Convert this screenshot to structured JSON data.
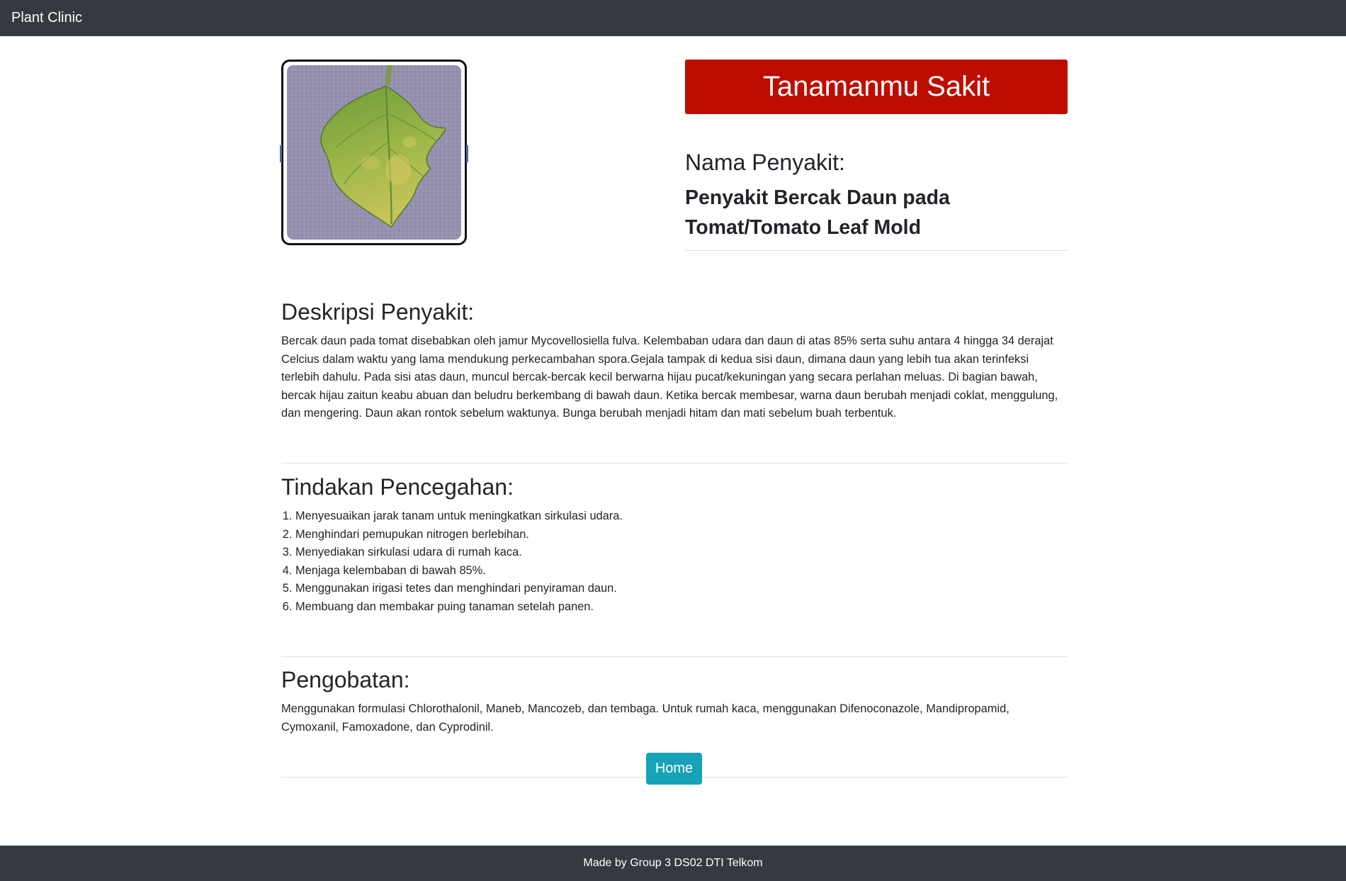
{
  "navbar": {
    "brand": "Plant Clinic"
  },
  "result": {
    "status": "Tanamanmu Sakit",
    "status_color": "#bd0d00",
    "name_label": "Nama Penyakit:",
    "disease_name": "Penyakit Bercak Daun pada Tomat/Tomato Leaf Mold"
  },
  "description": {
    "title": "Deskripsi Penyakit:",
    "text": "Bercak daun pada tomat disebabkan oleh jamur Mycovellosiella fulva. Kelembaban udara dan daun di atas 85% serta suhu antara 4 hingga 34 derajat Celcius dalam waktu yang lama mendukung perkecambahan spora.Gejala tampak di kedua sisi daun, dimana daun yang lebih tua akan terinfeksi terlebih dahulu. Pada sisi atas daun, muncul bercak-bercak kecil berwarna hijau pucat/kekuningan yang secara perlahan meluas. Di bagian bawah, bercak hijau zaitun keabu abuan dan beludru berkembang di bawah daun. Ketika bercak membesar, warna daun berubah menjadi coklat, menggulung, dan mengering. Daun akan rontok sebelum waktunya. Bunga berubah menjadi hitam dan mati sebelum buah terbentuk."
  },
  "prevention": {
    "title": "Tindakan Pencegahan:",
    "items": [
      "Menyesuaikan jarak tanam untuk meningkatkan sirkulasi udara.",
      "Menghindari pemupukan nitrogen berlebihan.",
      "Menyediakan sirkulasi udara di rumah kaca.",
      "Menjaga kelembaban di bawah 85%.",
      "Menggunakan irigasi tetes dan menghindari penyiraman daun.",
      "Membuang dan membakar puing tanaman setelah panen."
    ]
  },
  "treatment": {
    "title": "Pengobatan:",
    "text": "Menggunakan formulasi Chlorothalonil, Maneb, Mancozeb, dan tembaga. Untuk rumah kaca, menggunakan Difenoconazole, Mandipropamid, Cymoxanil, Famoxadone, dan Cyprodinil."
  },
  "actions": {
    "home_label": "Home",
    "home_color": "#17a2b8"
  },
  "footer": {
    "text": "Made by Group 3 DS02 DTI Telkom"
  },
  "images": {
    "leaf_photo": "tomato-leaf-mold-photo"
  }
}
